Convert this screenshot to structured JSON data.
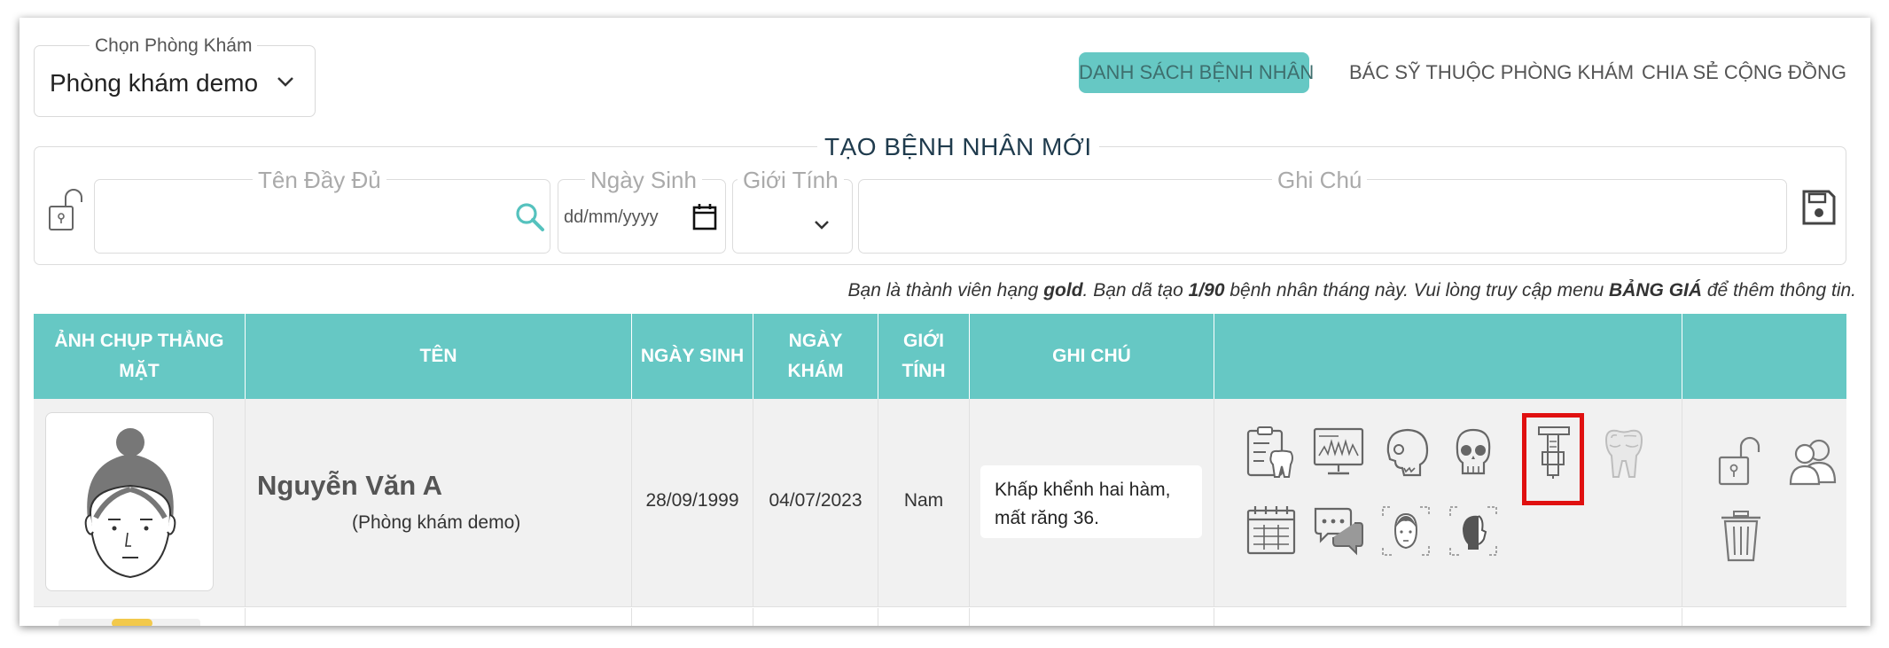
{
  "clinic_selector": {
    "legend": "Chọn Phòng Khám",
    "value": "Phòng khám demo"
  },
  "nav": {
    "patients": "DANH SÁCH BỆNH NHÂN",
    "doctors": "BÁC SỸ THUỘC PHÒNG KHÁM",
    "community": "CHIA SẺ CỘNG ĐỒNG"
  },
  "form": {
    "title": "TẠO BỆNH NHÂN MỚI",
    "fullname_label": "Tên Đầy Đủ",
    "dob_label": "Ngày Sinh",
    "dob_placeholder": "dd/mm/yyyy",
    "gender_label": "Giới Tính",
    "note_label": "Ghi Chú"
  },
  "notice": {
    "p1": "Bạn là thành viên hạng ",
    "rank": "gold",
    "p2": ".  Bạn dã tạo ",
    "count": "1/90",
    "p3": " bệnh nhân tháng này.  Vui lòng truy cập menu ",
    "menu": "BẢNG GIÁ",
    "p4": " để thêm thông tin."
  },
  "table": {
    "headers": {
      "photo": "ẢNH CHỤP THẲNG MẶT",
      "name": "TÊN",
      "dob": "NGÀY SINH",
      "visit": "NGÀY KHÁM",
      "gender": "GIỚI TÍNH",
      "note": "GHI CHÚ"
    },
    "rows": [
      {
        "name": "Nguyễn Văn A",
        "clinic": "(Phòng khám demo)",
        "dob": "28/09/1999",
        "visit": "04/07/2023",
        "gender": "Nam",
        "note": "Khấp khểnh hai hàm, mất răng 36."
      }
    ]
  },
  "colors": {
    "accent": "#66c8c4",
    "highlight": "#e01010"
  },
  "icons": [
    "tooth-chart-icon",
    "xray-monitor-icon",
    "skull-side-icon",
    "skull-front-icon",
    "caliper-icon",
    "tooth-xray-icon",
    "calendar-icon",
    "chat-icon",
    "face-front-icon",
    "face-side-icon",
    "unlock-icon",
    "users-icon",
    "trash-icon",
    "save-icon"
  ]
}
